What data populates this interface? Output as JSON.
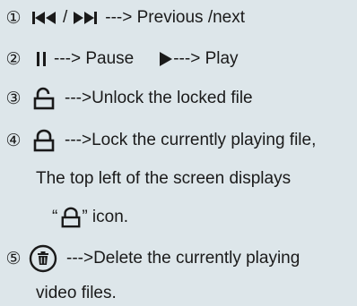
{
  "items": [
    {
      "num": "①",
      "separator": "/",
      "text": "---> Previous /next"
    },
    {
      "num": "②",
      "pause_text": "---> Pause",
      "play_text": "---> Play"
    },
    {
      "num": "③",
      "text": "--->Unlock the locked file"
    },
    {
      "num": "④",
      "text": "--->Lock the currently playing file,",
      "line2": "The top left of the screen displays",
      "line3_open": "“",
      "line3_close": "” icon."
    },
    {
      "num": "⑤",
      "text": "--->Delete the currently playing",
      "line2": "video files."
    }
  ],
  "icon_color": "#1a1a1a",
  "icons": [
    "previous-icon",
    "next-icon",
    "pause-icon",
    "play-icon",
    "unlock-icon",
    "lock-icon",
    "trash-icon"
  ]
}
